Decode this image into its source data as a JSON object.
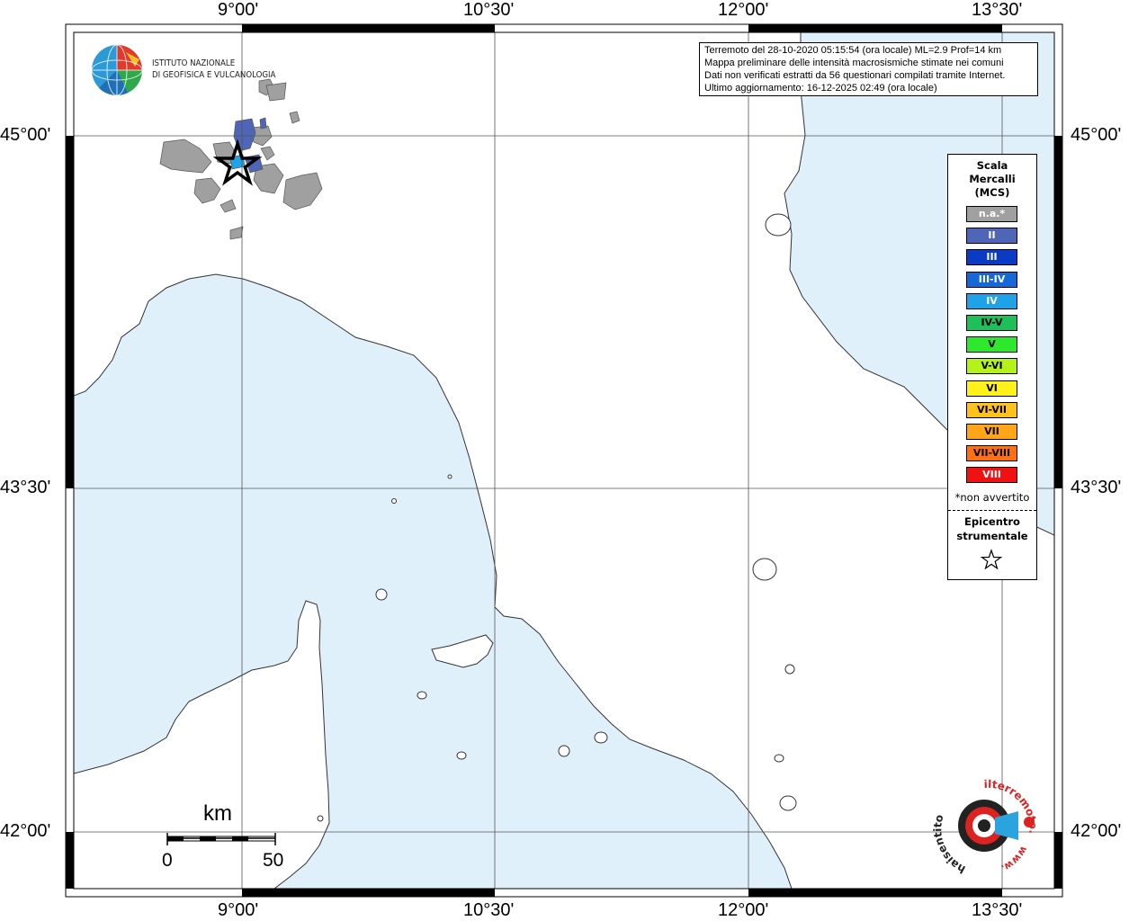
{
  "map": {
    "lon_labels": [
      "9°00'",
      "10°30'",
      "12°00'",
      "13°30'"
    ],
    "lat_labels": [
      "45°00'",
      "43°30'",
      "42°00'"
    ],
    "colors": {
      "sea": "#dff0fb",
      "land": "#ffffff",
      "coast": "#333333"
    }
  },
  "info": {
    "line1": "Terremoto del 28-10-2020 05:15:54 (ora locale) ML=2.9 Prof=14 km",
    "line2": "Mappa preliminare delle intensità macrosismiche stimate nei comuni",
    "line3": "Dati non verificati estratti da 56 questionari compilati tramite Internet.",
    "line4": "Ultimo aggiornamento: 16-12-2025 02:49 (ora locale)"
  },
  "institute": {
    "line1": "ISTITUTO NAZIONALE",
    "line2": "DI GEOFISICA E VULCANOLOGIA",
    "logo_icon": "ingv-globe-icon"
  },
  "legend": {
    "title1": "Scala",
    "title2": "Mercalli",
    "title3": "(MCS)",
    "items": [
      {
        "label": "n.a.*",
        "color": "#a0a0a0",
        "text_color": "#ffffff"
      },
      {
        "label": "II",
        "color": "#4f65b8",
        "text_color": "#ffffff"
      },
      {
        "label": "III",
        "color": "#0b3bc4",
        "text_color": "#ffffff"
      },
      {
        "label": "III-IV",
        "color": "#1668d8",
        "text_color": "#ffffff"
      },
      {
        "label": "IV",
        "color": "#1ea3e8",
        "text_color": "#ffffff"
      },
      {
        "label": "IV-V",
        "color": "#1fbf5a",
        "text_color": "#000000"
      },
      {
        "label": "V",
        "color": "#2ee82e",
        "text_color": "#000000"
      },
      {
        "label": "V-VI",
        "color": "#b5f21a",
        "text_color": "#000000"
      },
      {
        "label": "VI",
        "color": "#fff21a",
        "text_color": "#000000"
      },
      {
        "label": "VI-VII",
        "color": "#ffc21a",
        "text_color": "#000000"
      },
      {
        "label": "VII",
        "color": "#ffa51a",
        "text_color": "#000000"
      },
      {
        "label": "VII-VIII",
        "color": "#ff7012",
        "text_color": "#000000"
      },
      {
        "label": "VIII",
        "color": "#f01212",
        "text_color": "#ffffff"
      }
    ],
    "note": "*non avvertito",
    "epicenter1": "Epicentro",
    "epicenter2": "strumentale"
  },
  "scale_bar": {
    "unit": "km",
    "start": "0",
    "end": "50"
  },
  "hsi_logo": {
    "text_left": "haisentito",
    "text_right": "ilterremoto.it",
    "url": "www."
  }
}
